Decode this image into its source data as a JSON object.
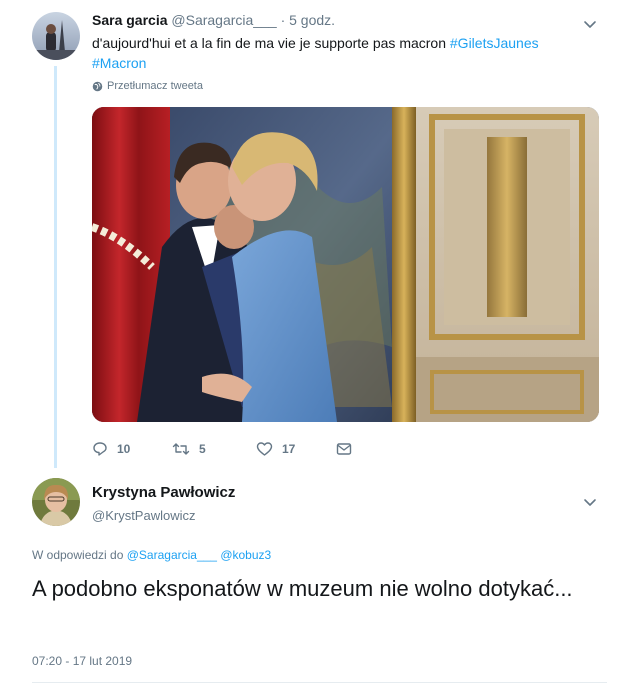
{
  "tweet1": {
    "author_name": "Sara garcia",
    "author_handle": "@Saragarcia___",
    "time": "· 5 godz.",
    "text": "d'aujourd'hui et a la fin de ma vie je supporte pas macron",
    "hashtag1": "#GiletsJaunes",
    "hashtag2": "#Macron",
    "translate_label": "Przetłumacz tweeta",
    "actions": {
      "replies": "10",
      "retweets": "5",
      "likes": "17"
    }
  },
  "tweet2": {
    "author_name": "Krystyna Pawłowicz",
    "author_handle": "@KrystPawlowicz",
    "reply_prefix": "W odpowiedzi do",
    "reply_to_1": "@Saragarcia___",
    "reply_to_2": "@kobuz3",
    "text": "A podobno eksponatów w muzeum nie wolno dotykać...",
    "timestamp": "07:20 - 17 lut 2019"
  },
  "colors": {
    "accent": "#1da1f2",
    "muted": "#657786",
    "thread_line": "#cfe9fb"
  },
  "icons": [
    "reply-icon",
    "retweet-icon",
    "like-icon",
    "dm-icon",
    "chevron-down-icon",
    "globe-icon"
  ]
}
